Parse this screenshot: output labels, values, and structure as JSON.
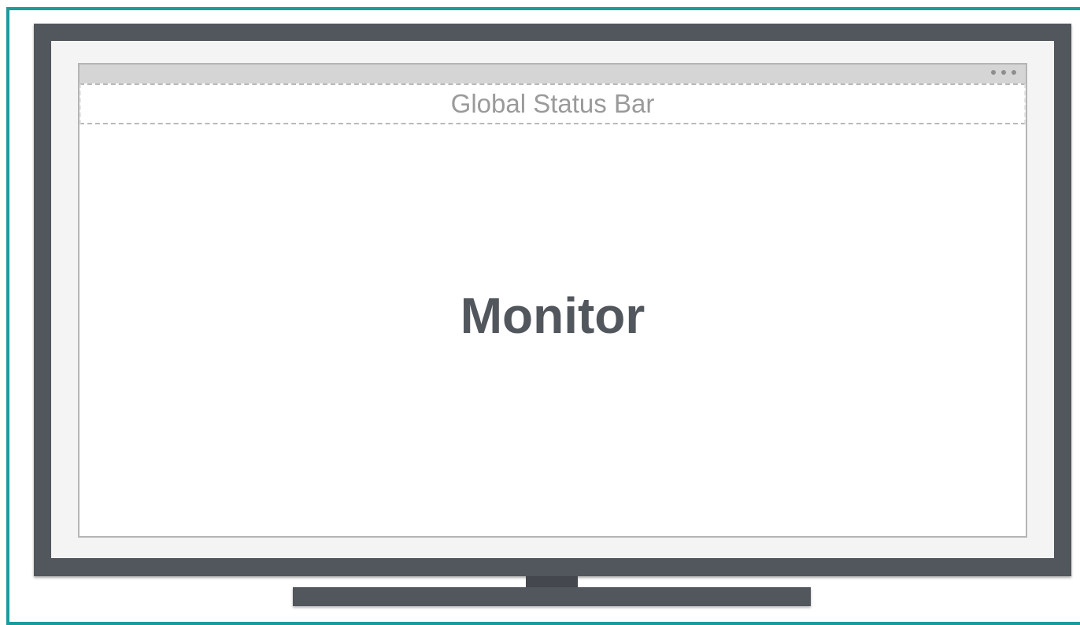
{
  "window": {
    "menu_icon": "more-dots-icon"
  },
  "status_bar": {
    "label": "Global Status Bar"
  },
  "device": {
    "label": "Monitor"
  },
  "colors": {
    "frame_accent": "#1a9c9b",
    "bezel": "#52565d",
    "screen_bg": "#f4f4f4",
    "titlebar": "#d5d5d5",
    "label_text": "#52565d",
    "status_text": "#9a9a9a"
  }
}
